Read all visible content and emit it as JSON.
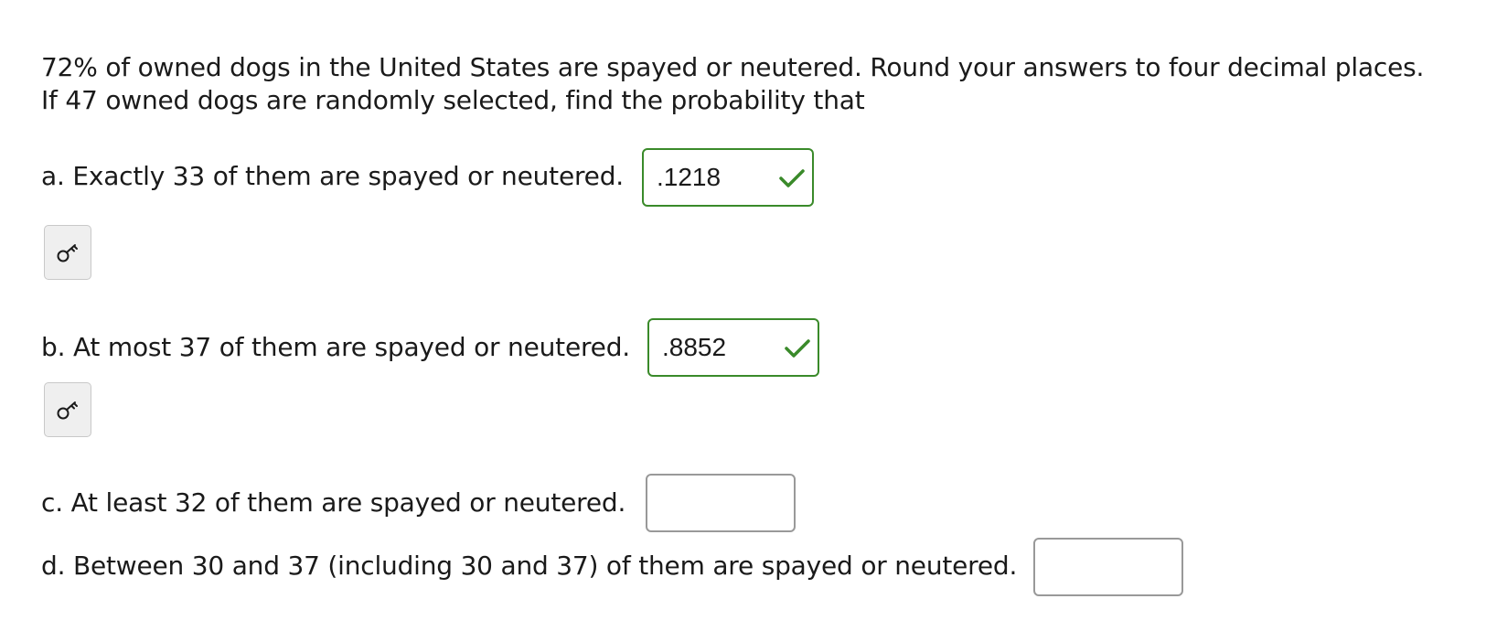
{
  "intro": {
    "line1": "72% of owned dogs in the United States are spayed or neutered. Round your answers to four decimal places.",
    "line2": "If 47 owned dogs are randomly selected, find the probability that"
  },
  "questions": [
    {
      "label": "a. Exactly 33 of them are spayed or neutered.",
      "answer": ".1218",
      "status": "correct"
    },
    {
      "label": "b. At most 37 of them are spayed or neutered.",
      "answer": ".8852",
      "status": "correct"
    },
    {
      "label": "c. At least 32 of them are spayed or neutered.",
      "answer": "",
      "status": "empty"
    },
    {
      "label": "d. Between 30 and 37 (including 30 and 37) of them are spayed or neutered.",
      "answer": "",
      "status": "empty"
    }
  ],
  "icons": {
    "correct": "checkmark-icon",
    "key": "key-icon"
  },
  "colors": {
    "correct_border": "#3a8a2a",
    "empty_border": "#999999",
    "key_button_bg": "#efefef"
  }
}
